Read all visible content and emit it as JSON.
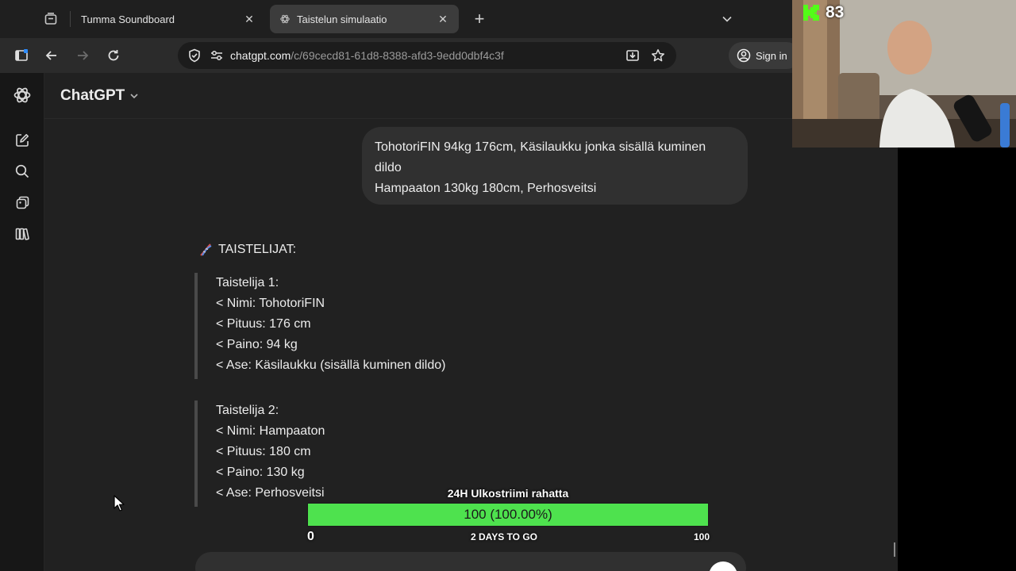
{
  "browser": {
    "tabs": [
      {
        "title": "Tumma Soundboard",
        "active": false
      },
      {
        "title": "Taistelun simulaatio",
        "active": true
      }
    ],
    "address": {
      "domain": "chatgpt.com",
      "path": "/c/69cecd81-61d8-8388-afd3-9edd0dbf4c3f"
    },
    "signin_label": "Sign in"
  },
  "app": {
    "model_name": "ChatGPT",
    "user_message": {
      "lines": [
        "TohotoriFIN 94kg 176cm, Käsilaukku jonka sisällä kuminen",
        "dildo",
        "Hampaaton 130kg 180cm, Perhosveitsi"
      ]
    },
    "section_title": "TAISTELIJAT:",
    "fighters": [
      {
        "header": "Taistelija 1:",
        "lines": [
          "< Nimi: TohotoriFIN",
          "< Pituus: 176 cm",
          "< Paino: 94 kg",
          "< Ase: Käsilaukku (sisällä kuminen dildo)"
        ]
      },
      {
        "header": "Taistelija 2:",
        "lines": [
          "< Nimi: Hampaaton",
          "< Pituus: 180 cm",
          "< Paino: 130 kg",
          "< Ase: Perhosveitsi"
        ]
      }
    ]
  },
  "overlay": {
    "goal": {
      "title": "24H Ulkostriimi rahatta",
      "value_text": "100 (100.00%)",
      "progress": 1.0,
      "min_label": "0",
      "sub_label": "2 DAYS TO GO",
      "max_label": "100",
      "fill_color": "#4ee24e"
    },
    "viewer_count": "83",
    "platform_color": "#53fc18"
  }
}
